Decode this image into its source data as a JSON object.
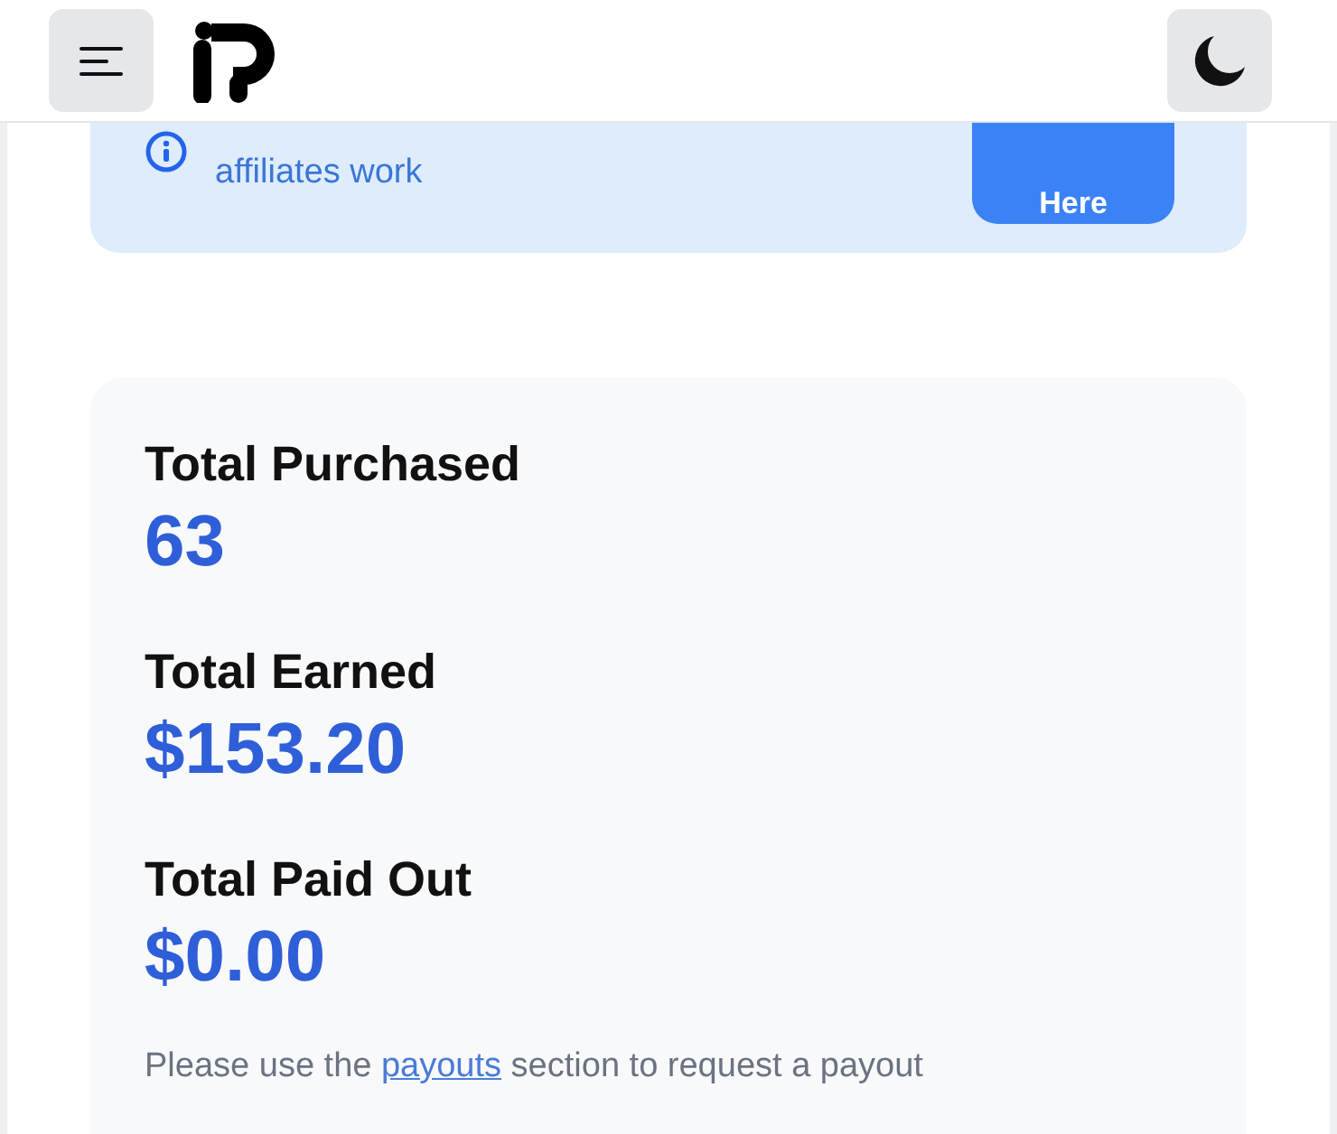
{
  "banner": {
    "text": "affiliates work",
    "button": "Here"
  },
  "stats": [
    {
      "label": "Total Purchased",
      "value": "63"
    },
    {
      "label": "Total Earned",
      "value": "$153.20"
    },
    {
      "label": "Total Paid Out",
      "value": "$0.00"
    }
  ],
  "note": {
    "before": "Please use the ",
    "link": "payouts",
    "after": " section to request a payout"
  }
}
